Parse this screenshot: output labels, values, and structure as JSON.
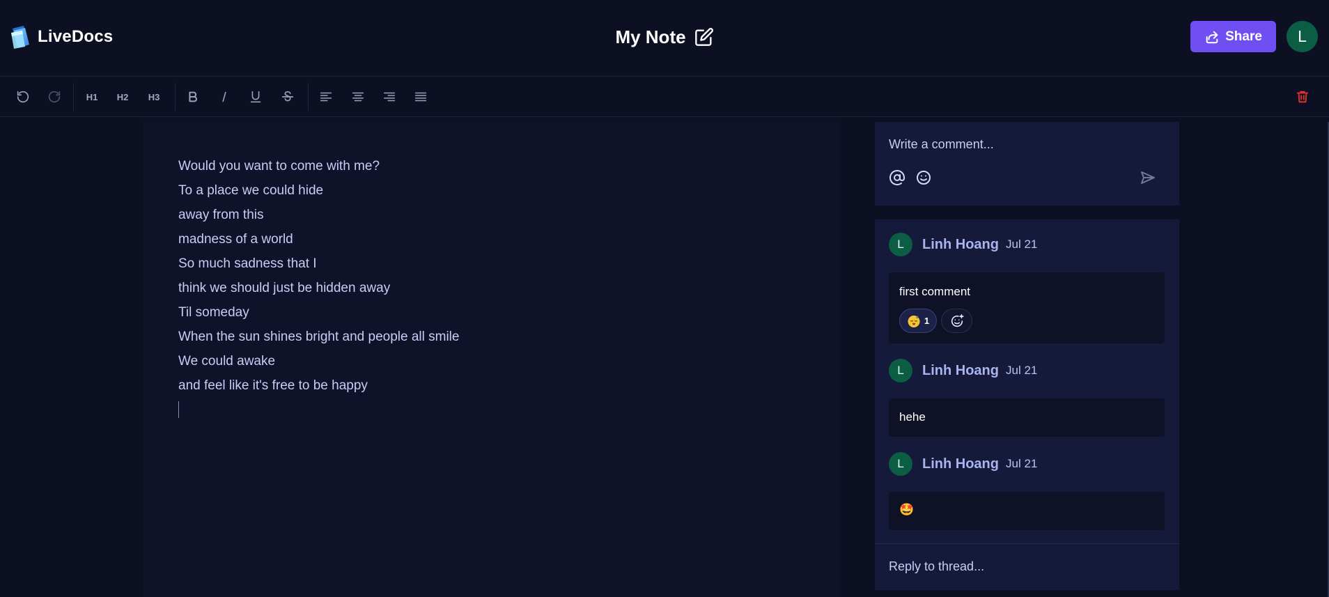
{
  "app": {
    "name": "LiveDocs"
  },
  "document": {
    "title": "My Note"
  },
  "header": {
    "share_label": "Share",
    "user_initial": "L"
  },
  "toolbar": {
    "undo_icon": "undo-icon",
    "redo_icon": "redo-icon",
    "h1": "H1",
    "h2": "H2",
    "h3": "H3",
    "trash_color": "#e5322f"
  },
  "editor": {
    "lines": [
      "Would you want to come with me?",
      "To a place we could hide",
      "away from this",
      "madness of a world",
      "So much sadness that I",
      "think we should just be hidden away",
      "Til someday",
      "When the sun shines bright and people all smile",
      "We could awake",
      "and feel like it's free to be happy"
    ]
  },
  "composer": {
    "placeholder": "Write a comment..."
  },
  "thread": {
    "comments": [
      {
        "author": "Linh Hoang",
        "initial": "L",
        "date": "Jul 21",
        "text": "first comment",
        "reaction_count": "1"
      },
      {
        "author": "Linh Hoang",
        "initial": "L",
        "date": "Jul 21",
        "text": "hehe"
      },
      {
        "author": "Linh Hoang",
        "initial": "L",
        "date": "Jul 21",
        "text": "🤩"
      }
    ],
    "reply_placeholder": "Reply to thread..."
  },
  "colors": {
    "background": "#0d1022",
    "accent": "#6f4ff2",
    "avatar": "#0b5e44",
    "panel": "#161a3a"
  }
}
